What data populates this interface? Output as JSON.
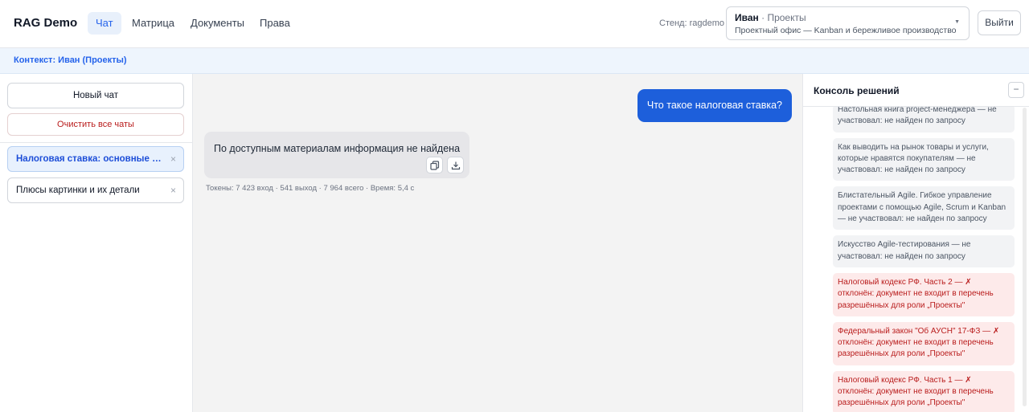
{
  "header": {
    "brand": "RAG Demo",
    "nav": [
      {
        "label": "Чат"
      },
      {
        "label": "Матрица"
      },
      {
        "label": "Документы"
      },
      {
        "label": "Права"
      }
    ],
    "stand_label": "Стенд: ragdemo",
    "context_select": {
      "name": "Иван",
      "separator": "·",
      "role": "Проекты",
      "subtitle": "Проектный офис — Kanban и бережливое производство",
      "caret_icon": "chevron-down-icon"
    },
    "logout_label": "Выйти"
  },
  "context_bar": {
    "text": "Контекст: Иван (Проекты)"
  },
  "sidebar": {
    "new_chat_label": "Новый чат",
    "clear_all_label": "Очистить все чаты",
    "chats": [
      {
        "label": "Налоговая ставка: основные по...",
        "close": "×"
      },
      {
        "label": "Плюсы картинки и их детали",
        "close": "×"
      }
    ]
  },
  "chat": {
    "user_message": "Что такое налоговая ставка?",
    "bot_message": "По доступным материалам информация не найдена",
    "stats": "Токены: 7 423 вход · 541 выход · 7 964 всего · Время: 5,4 с"
  },
  "console": {
    "title": "Консоль решений",
    "collapse_label": "−",
    "entries": [
      {
        "status": "neutral",
        "text": "Настольная книга project-менеджера — не участвовал: не найден по запросу"
      },
      {
        "status": "neutral",
        "text": "Как выводить на рынок товары и услуги, которые нравятся покупателям — не участвовал: не найден по запросу"
      },
      {
        "status": "neutral",
        "text": "Блистательный Agile. Гибкое управление проектами с помощью Agile, Scrum и Kanban — не участвовал: не найден по запросу"
      },
      {
        "status": "neutral",
        "text": "Искусство Agile-тестирования — не участвовал: не найден по запросу"
      },
      {
        "status": "rejected",
        "text": "Налоговый кодекс РФ. Часть 2 — ✗ отклонён: документ не входит в перечень разрешённых для роли „Проекты\""
      },
      {
        "status": "rejected",
        "text": "Федеральный закон \"Об АУСН\" 17-ФЗ — ✗ отклонён: документ не входит в перечень разрешённых для роли „Проекты\""
      },
      {
        "status": "rejected",
        "text": "Налоговый кодекс РФ. Часть 1 — ✗ отклонён: документ не входит в перечень разрешённых для роли „Проекты\""
      }
    ]
  },
  "colors": {
    "accent": "#2563eb",
    "user_bubble": "#1d5fdb",
    "danger": "#b91c1c",
    "rejected_bg": "#fdeaea"
  }
}
